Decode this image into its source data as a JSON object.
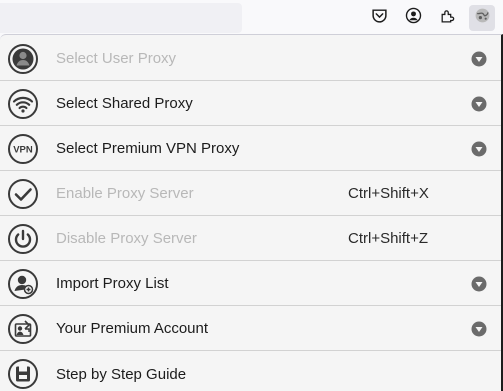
{
  "toolbar": {
    "icons": [
      "pocket-icon",
      "account-icon",
      "extensions-icon",
      "proxy-extension-icon"
    ]
  },
  "menu": {
    "items": [
      {
        "label": "Select User Proxy",
        "icon": "user-proxy-icon",
        "enabled": false,
        "has_submenu": true
      },
      {
        "label": "Select Shared Proxy",
        "icon": "wifi-icon",
        "enabled": true,
        "has_submenu": true
      },
      {
        "label": "Select Premium VPN Proxy",
        "icon": "vpn-icon",
        "icon_text": "VPN",
        "enabled": true,
        "has_submenu": true
      },
      {
        "label": "Enable Proxy Server",
        "icon": "check-circle-icon",
        "enabled": false,
        "shortcut": "Ctrl+Shift+X"
      },
      {
        "label": "Disable Proxy Server",
        "icon": "power-icon",
        "enabled": false,
        "shortcut": "Ctrl+Shift+Z"
      },
      {
        "label": "Import Proxy List",
        "icon": "import-icon",
        "enabled": true,
        "has_submenu": true
      },
      {
        "label": "Your Premium Account",
        "icon": "premium-account-icon",
        "enabled": true,
        "has_submenu": true
      },
      {
        "label": "Step by Step Guide",
        "icon": "guide-icon",
        "enabled": true
      }
    ]
  },
  "colors": {
    "enabled_text": "#1c1c1c",
    "disabled_text": "#b8b8b8",
    "icon_dark": "#3a3a3a",
    "submenu_arrow": "#6b6b6b"
  }
}
